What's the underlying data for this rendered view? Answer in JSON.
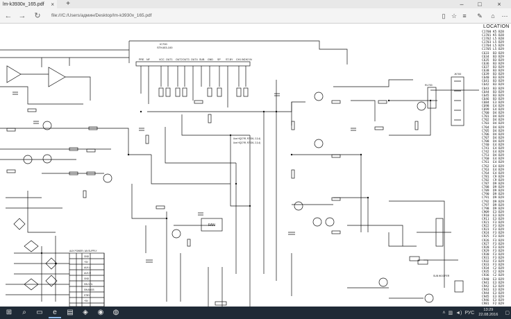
{
  "tab": {
    "title": "lm-k3930x_165.pdf"
  },
  "address": {
    "url": "file:///C:/Users/админ/Desktop/lm-k3930x_165.pdf"
  },
  "panel": {
    "title": "LOCATION",
    "rows": [
      [
        "C1700",
        "K5",
        "B28"
      ],
      [
        "C1701",
        "K5",
        "B28"
      ],
      [
        "C1702",
        "L5",
        "B28"
      ],
      [
        "C1703",
        "L5",
        "B29"
      ],
      [
        "C1704",
        "L5",
        "B29"
      ],
      [
        "C1705",
        "L5",
        "B29"
      ],
      [
        "C633",
        "B3",
        "B29"
      ],
      [
        "C634",
        "B3",
        "B29"
      ],
      [
        "C635",
        "B3",
        "B29"
      ],
      [
        "C636",
        "B3",
        "B29"
      ],
      [
        "C637",
        "B3",
        "B29"
      ],
      [
        "C638",
        "B3",
        "B29"
      ],
      [
        "C639",
        "B3",
        "B29"
      ],
      [
        "C640",
        "B3",
        "B29"
      ],
      [
        "C641",
        "B3",
        "B29"
      ],
      [
        "C642",
        "B3",
        "B29"
      ],
      [
        "C643",
        "B3",
        "B29"
      ],
      [
        "C644",
        "B3",
        "B29"
      ],
      [
        "C645",
        "B3",
        "B29"
      ],
      [
        "C646",
        "B3",
        "B29"
      ],
      [
        "C684",
        "E3",
        "B29"
      ],
      [
        "C698",
        "E4",
        "B29"
      ],
      [
        "C699",
        "E4",
        "B29"
      ],
      [
        "C700",
        "D4",
        "B29"
      ],
      [
        "C701",
        "D4",
        "B29"
      ],
      [
        "C702",
        "D4",
        "B29"
      ],
      [
        "C703",
        "D4",
        "B29"
      ],
      [
        "C704",
        "D4",
        "B29"
      ],
      [
        "C705",
        "D4",
        "B29"
      ],
      [
        "C706",
        "D4",
        "B29"
      ],
      [
        "C707",
        "D4",
        "B29"
      ],
      [
        "C708",
        "D4",
        "B29"
      ],
      [
        "C740",
        "E4",
        "B29"
      ],
      [
        "C741",
        "E4",
        "B29"
      ],
      [
        "C742",
        "E4",
        "B29"
      ],
      [
        "C753",
        "D4",
        "B29"
      ],
      [
        "C760",
        "E4",
        "B29"
      ],
      [
        "C761",
        "E4",
        "B29"
      ],
      [
        "C762",
        "E4",
        "B29"
      ],
      [
        "C763",
        "E4",
        "B29"
      ],
      [
        "C764",
        "E4",
        "B29"
      ],
      [
        "C781",
        "C9",
        "B29"
      ],
      [
        "C782",
        "C9",
        "B29"
      ],
      [
        "C787",
        "D9",
        "B29"
      ],
      [
        "C788",
        "D9",
        "B29"
      ],
      [
        "C789",
        "D9",
        "B29"
      ],
      [
        "C790",
        "D9",
        "B29"
      ],
      [
        "C791",
        "D9",
        "B29"
      ],
      [
        "C792",
        "D9",
        "B29"
      ],
      [
        "C797",
        "D9",
        "B29"
      ],
      [
        "C798",
        "D9",
        "B29"
      ],
      [
        "C909",
        "E3",
        "B29"
      ],
      [
        "C910",
        "E3",
        "B29"
      ],
      [
        "C911",
        "E3",
        "B29"
      ],
      [
        "C921",
        "F3",
        "B29"
      ],
      [
        "C922",
        "F3",
        "B29"
      ],
      [
        "C923",
        "F3",
        "B29"
      ],
      [
        "C924",
        "F3",
        "B29"
      ],
      [
        "C925",
        "F3",
        "B29"
      ],
      [
        "C926",
        "F3",
        "B29"
      ],
      [
        "C927",
        "F3",
        "B29"
      ],
      [
        "C928",
        "F3",
        "B29"
      ],
      [
        "C929",
        "F3",
        "B29"
      ],
      [
        "C930",
        "F3",
        "B29"
      ],
      [
        "C931",
        "F3",
        "B29"
      ],
      [
        "C932",
        "F3",
        "B29"
      ],
      [
        "C933",
        "F3",
        "B29"
      ],
      [
        "C934",
        "C2",
        "B29"
      ],
      [
        "C935",
        "C2",
        "B29"
      ],
      [
        "C936",
        "C2",
        "B29"
      ],
      [
        "C940",
        "E3",
        "B29"
      ],
      [
        "C941",
        "E3",
        "B29"
      ],
      [
        "C942",
        "E3",
        "B29"
      ],
      [
        "C943",
        "E3",
        "B29"
      ],
      [
        "C944",
        "E3",
        "B29"
      ],
      [
        "C945",
        "E3",
        "B29"
      ],
      [
        "C946",
        "E3",
        "B29"
      ],
      [
        "C981",
        "F2",
        "B29"
      ],
      [
        "C982",
        "F2",
        "B29"
      ],
      [
        "C983",
        "F2",
        "B29"
      ],
      [
        "C984",
        "F2",
        "B29"
      ],
      [
        "C985",
        "F2",
        "B29"
      ],
      [
        "C986",
        "F2",
        "B29"
      ],
      [
        "C987",
        "F2",
        "B29"
      ],
      [
        "C988",
        "F2",
        "B29"
      ],
      [
        "C989",
        "F2",
        "B29"
      ],
      [
        "C990",
        "F2",
        "B29"
      ],
      [
        "C991",
        "F2",
        "B29"
      ],
      [
        "C992",
        "F2",
        "B29"
      ],
      [
        "C993",
        "F2",
        "B29"
      ],
      [
        "C994",
        "F2",
        "B29"
      ],
      [
        "C995",
        "F2",
        "B29"
      ],
      [
        "C996",
        "F2",
        "B29"
      ],
      [
        "C9901",
        "F3",
        "B29"
      ],
      [
        "C9902",
        "F3",
        "B29"
      ],
      [
        "C9903",
        "F3",
        "B29"
      ],
      [
        "C9904",
        "F3",
        "B29"
      ],
      [
        "C9905",
        "F3",
        "B29"
      ],
      [
        "C9906",
        "F3",
        "B29"
      ],
      [
        "C9907",
        "F3",
        "B29"
      ],
      [
        "C9908",
        "F3",
        "B29"
      ],
      [
        "C9909",
        "F3",
        "B29"
      ],
      [
        "C9910",
        "F3",
        "B29"
      ],
      [
        "C9911",
        "F3",
        "B29"
      ],
      [
        "C9912",
        "F3",
        "B29"
      ],
      [
        "C9913",
        "F3",
        "B29"
      ]
    ]
  },
  "schematic": {
    "ic_label": "IC700",
    "ic_part": "STK403-100",
    "pins": [
      "PRE",
      "NF",
      "VCC",
      "OUT1",
      "OUT2",
      "OUT3",
      "OUT4",
      "SUB",
      "GND",
      "SP",
      "ST-BY",
      "CH1 IN",
      "CH2 IN"
    ],
    "fan_label": "FAN",
    "table_title": "AUX POWER / AN SUPPLY",
    "table_rows": [
      "GND",
      "+5V",
      "AUX-L",
      "AUX-R",
      "GND",
      "SW-VOL",
      "SW-BASS",
      "STBY",
      "+5V"
    ],
    "relay_label": "RL700",
    "jack_label": "JK700",
    "subwoofer_label": "SUB WOOFER",
    "note1": "Use HQ27IR, R7026, 2,3,4)",
    "note2": "Use HQ27IR, R7026, 2,3,4)"
  },
  "taskbar": {
    "lang": "РУС",
    "time": "13:29",
    "date": "22.08.2016"
  }
}
